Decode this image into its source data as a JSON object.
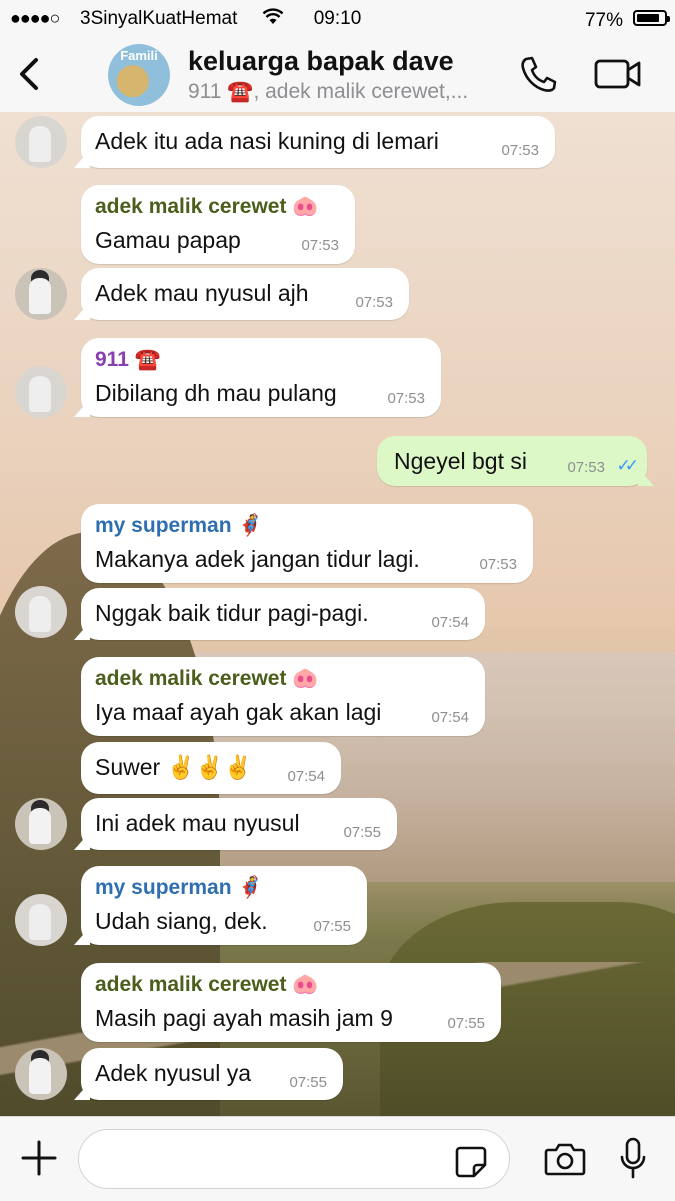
{
  "status": {
    "signal": "●●●●○",
    "carrier": "3SinyalKuatHemat",
    "time": "09:10",
    "battery": "77%"
  },
  "header": {
    "title": "keluarga bapak dave",
    "subtitle": "911 ☎️, adek malik cerewet,...",
    "group_avatar_text": "Famili"
  },
  "messages": [
    {
      "sender": "",
      "text": "Adek itu ada nasi kuning di lemari",
      "time": "07:53"
    },
    {
      "sender": "adek malik cerewet 🐽",
      "text": "Gamau papap",
      "time": "07:53"
    },
    {
      "sender": "",
      "text": "Adek mau nyusul ajh",
      "time": "07:53"
    },
    {
      "sender": "911 ☎️",
      "text": "Dibilang dh mau pulang",
      "time": "07:53"
    },
    {
      "sender": "",
      "text": "Ngeyel bgt si",
      "time": "07:53"
    },
    {
      "sender": "my superman 🦸",
      "text": "Makanya adek jangan tidur lagi.",
      "time": "07:53"
    },
    {
      "sender": "",
      "text": "Nggak baik tidur pagi-pagi.",
      "time": "07:54"
    },
    {
      "sender": "adek malik cerewet 🐽",
      "text": "Iya maaf ayah gak akan lagi",
      "time": "07:54"
    },
    {
      "sender": "",
      "text": "Suwer ✌️✌️✌️",
      "time": "07:54"
    },
    {
      "sender": "",
      "text": "Ini adek mau nyusul",
      "time": "07:55"
    },
    {
      "sender": "my superman 🦸",
      "text": "Udah siang, dek.",
      "time": "07:55"
    },
    {
      "sender": "adek malik cerewet 🐽",
      "text": "Masih pagi ayah masih jam 9",
      "time": "07:55"
    },
    {
      "sender": "",
      "text": "Adek nyusul ya",
      "time": "07:55"
    }
  ],
  "read_ticks": "✓✓",
  "colors": {
    "sender_green": "#4b5e1c",
    "sender_purple": "#8a3fb0",
    "sender_blue": "#2f6fb0",
    "outgoing_bubble": "#dcf8c6",
    "tick_blue": "#3497f9"
  }
}
